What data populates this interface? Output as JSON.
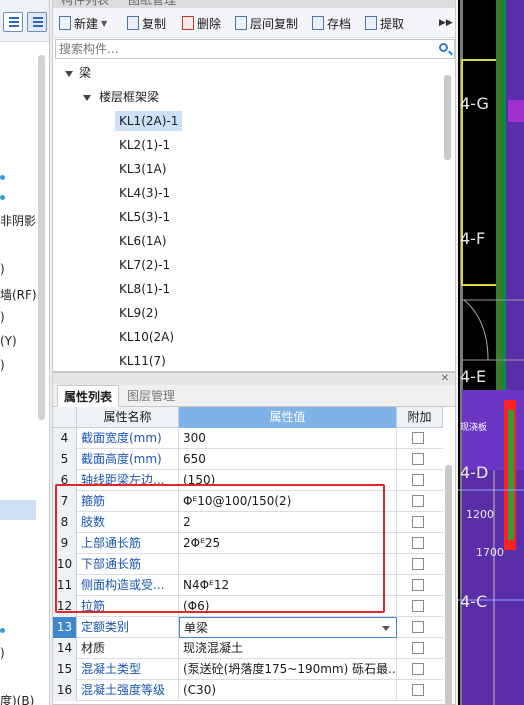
{
  "left_panel": {
    "texts": [
      "非阴影",
      ")",
      "墙(RF)",
      ")",
      "(Y)",
      ")",
      ")",
      "度)(B)"
    ]
  },
  "component_panel": {
    "tabs": [
      "构件列表",
      "图纸管理"
    ],
    "toolbar": {
      "new": "新建",
      "copy": "复制",
      "delete": "删除",
      "layer_copy": "层间复制",
      "save": "存档",
      "extract": "提取"
    },
    "search_placeholder": "搜索构件...",
    "tree": {
      "root": "梁",
      "group": "楼层框架梁",
      "items": [
        "KL1(2A)-1",
        "KL2(1)-1",
        "KL3(1A)",
        "KL4(3)-1",
        "KL5(3)-1",
        "KL6(1A)",
        "KL7(2)-1",
        "KL8(1)-1",
        "KL9(2)",
        "KL10(2A)",
        "KL11(7)"
      ],
      "selected_index": 0
    }
  },
  "property_panel": {
    "tabs": [
      "属性列表",
      "图层管理"
    ],
    "headers": [
      "属性名称",
      "属性值",
      "附加"
    ],
    "rows": [
      {
        "num": "4",
        "name": "截面宽度(mm)",
        "value": "300"
      },
      {
        "num": "5",
        "name": "截面高度(mm)",
        "value": "650"
      },
      {
        "num": "6",
        "name": "轴线距梁左边...",
        "value": "(150)"
      },
      {
        "num": "7",
        "name": "箍筋",
        "value": "Φᴱ10@100/150(2)"
      },
      {
        "num": "8",
        "name": "肢数",
        "value": "2"
      },
      {
        "num": "9",
        "name": "上部通长筋",
        "value": "2Φᴱ25"
      },
      {
        "num": "10",
        "name": "下部通长筋",
        "value": ""
      },
      {
        "num": "11",
        "name": "侧面构造或受...",
        "value": "N4Φᴱ12"
      },
      {
        "num": "12",
        "name": "拉筋",
        "value": "(Φ6)"
      },
      {
        "num": "13",
        "name": "定额类别",
        "value": "单梁"
      },
      {
        "num": "14",
        "name": "材质",
        "value": "现浇混凝土"
      },
      {
        "num": "15",
        "name": "混凝土类型",
        "value": "(泵送砼(坍落度175~190mm) 砾石最..."
      },
      {
        "num": "16",
        "name": "混凝土强度等级",
        "value": "(C30)"
      }
    ],
    "active_row": "13"
  },
  "drawing": {
    "labels": [
      "4-G",
      "4-F",
      "4-E",
      "4-D",
      "4-C",
      "1200",
      "1700",
      "现浇板"
    ]
  },
  "colors": {
    "highlight_box": "#e1262c",
    "grid_header_value": "#7fb2e6",
    "selected_item": "#cce0f6",
    "link_text": "#1a56b0",
    "cad_purple": "#5a2ea8",
    "cad_yellow": "#d6d639"
  }
}
